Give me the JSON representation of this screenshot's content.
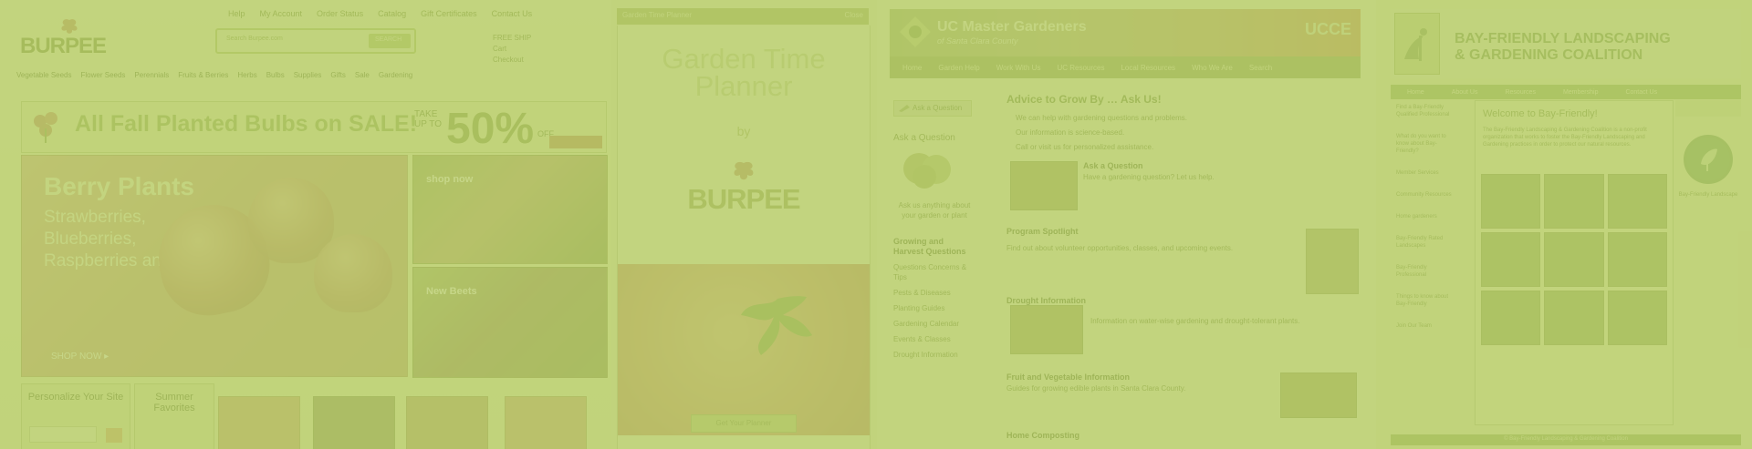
{
  "panel1": {
    "top_links": [
      "Help",
      "My Account",
      "Order Status",
      "Catalog",
      "Gift Certificates",
      "Contact Us"
    ],
    "logo_text": "BURPEE",
    "search_placeholder": "Search Burpee.com",
    "search_button": "SEARCH",
    "right_links": [
      "FREE SHIP",
      "Cart",
      "Checkout"
    ],
    "main_nav": [
      "Vegetable Seeds",
      "Flower Seeds",
      "Perennials",
      "Fruits & Berries",
      "Herbs",
      "Bulbs",
      "Supplies",
      "Gifts",
      "Sale",
      "Gardening"
    ],
    "sale_headline": "All Fall Planted Bulbs on SALE!",
    "sale_take": "TAKE UP TO",
    "sale_percent": "50%",
    "sale_off": "OFF",
    "hero_title": "Berry Plants",
    "hero_subtitle": "Strawberries, Blueberries, Raspberries and more!",
    "hero_cta": "SHOP NOW ▸",
    "thumb1_label": "shop now",
    "thumb2_label": "New Beets",
    "planner_title": "Personalize Your Site",
    "summer_title": "Summer Favorites"
  },
  "panel2": {
    "topbar_left": "Garden Time Planner",
    "topbar_right": "Close",
    "title": "Garden Time Planner",
    "by": "by",
    "logo_text": "BURPEE",
    "cta": "Get Your Planner"
  },
  "panel3": {
    "banner_title": "UC Master Gardeners",
    "banner_subtitle": "of Santa Clara County",
    "banner_right": "UCCE",
    "nav": [
      "Home",
      "Garden Help",
      "Work With Us",
      "UC Resources",
      "Local Resources",
      "Who We Are",
      "Search"
    ],
    "ask_button": "Ask a Question",
    "ask_label": "Ask a Question",
    "ask_caption": "Ask us anything about your garden or plant",
    "side_heading": "Growing and Harvest Questions",
    "side_links": [
      "Questions Concerns & Tips",
      "Pests & Diseases",
      "Planting Guides",
      "Gardening Calendar",
      "Events & Classes",
      "Drought Information"
    ],
    "heading": "Advice to Grow By … Ask Us!",
    "bullets": [
      "We can help with gardening questions and problems.",
      "Our information is science-based.",
      "Call or visit us for personalized assistance."
    ],
    "section1_title": "Ask a Question",
    "section1_text": "Have a gardening question? Let us help.",
    "spotlight_title": "Program Spotlight",
    "spotlight_text": "Find out about volunteer opportunities, classes, and upcoming events.",
    "section2_title": "Drought Information",
    "section2_text": "Information on water-wise gardening and drought-tolerant plants.",
    "section3_title": "Fruit and Vegetable Information",
    "section3_text": "Guides for growing edible plants in Santa Clara County.",
    "section4_title": "Home Composting"
  },
  "panel4": {
    "title_line1": "BAY-FRIENDLY LANDSCAPING",
    "title_line2": "& GARDENING COALITION",
    "nav": [
      "Home",
      "About Us",
      "Resources",
      "Membership",
      "Contact Us"
    ],
    "left_items": [
      "Find a Bay-Friendly Qualified Professional",
      "What do you want to know about Bay-Friendly?",
      "Member Services",
      "Community Resources",
      "Home gardeners",
      "Bay-Friendly Rated Landscapes",
      "Bay-Friendly Professional",
      "Things to know about Bay-Friendly",
      "Join Our Team"
    ],
    "welcome": "Welcome to Bay-Friendly!",
    "intro": "The Bay-Friendly Landscaping & Gardening Coalition is a non-profit organization that works to foster the Bay-Friendly Landscaping and Gardening practices in order to protect our natural resources.",
    "footer": "© Bay-Friendly Landscaping & Gardening Coalition",
    "badge_text": "Bay-Friendly Landscape"
  }
}
